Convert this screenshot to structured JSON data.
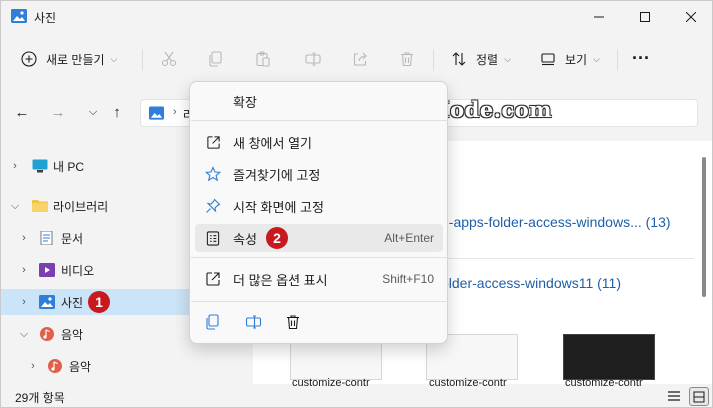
{
  "window": {
    "title": "사진",
    "controls": [
      "minimize-icon",
      "maximize-icon",
      "close-icon"
    ]
  },
  "toolbar": {
    "new_label": "새로 만들기",
    "sort_label": "정렬",
    "view_label": "보기",
    "more_label": "...",
    "icons": [
      "cut-icon",
      "copy-icon",
      "paste-icon",
      "rename-icon",
      "share-icon",
      "delete-icon"
    ]
  },
  "address": {
    "path_fragment": "라"
  },
  "watermark": "TabMode.com",
  "nav": {
    "items": [
      {
        "label": "내 PC",
        "icon": "pc-icon",
        "expanded": false
      },
      {
        "label": "라이브러리",
        "icon": "library-folder-icon",
        "expanded": true
      },
      {
        "label": "문서",
        "icon": "documents-icon",
        "expanded": false
      },
      {
        "label": "비디오",
        "icon": "videos-icon",
        "expanded": false
      },
      {
        "label": "사진",
        "icon": "pictures-icon",
        "expanded": false,
        "selected": true,
        "badge": "1"
      },
      {
        "label": "음악",
        "icon": "music-icon",
        "expanded": true
      },
      {
        "label": "음악",
        "icon": "music-icon",
        "expanded": false
      }
    ]
  },
  "content": {
    "group1": "d-apps-folder-access-windows... (13)",
    "group2": "older-access-windows11 (11)",
    "thumbs": [
      "customize-contr",
      "customize-contr",
      "customize-contr"
    ]
  },
  "status": {
    "item_count": "29개 항목"
  },
  "context_menu": {
    "header": "확장",
    "items": [
      {
        "label": "새 창에서 열기",
        "icon": "open-new-window-icon",
        "shortcut": ""
      },
      {
        "label": "즐겨찾기에 고정",
        "icon": "star-icon",
        "shortcut": ""
      },
      {
        "label": "시작 화면에 고정",
        "icon": "pin-icon",
        "shortcut": ""
      },
      {
        "label": "속성",
        "icon": "properties-icon",
        "shortcut": "Alt+Enter",
        "badge": "2"
      },
      {
        "label": "더 많은 옵션 표시",
        "icon": "more-options-icon",
        "shortcut": "Shift+F10"
      }
    ],
    "bottom_icons": [
      "copy-icon",
      "rename-icon",
      "delete-icon"
    ]
  },
  "colors": {
    "accent": "#1f5fa8",
    "selected": "#cce4f7",
    "badge": "#c8191f"
  }
}
